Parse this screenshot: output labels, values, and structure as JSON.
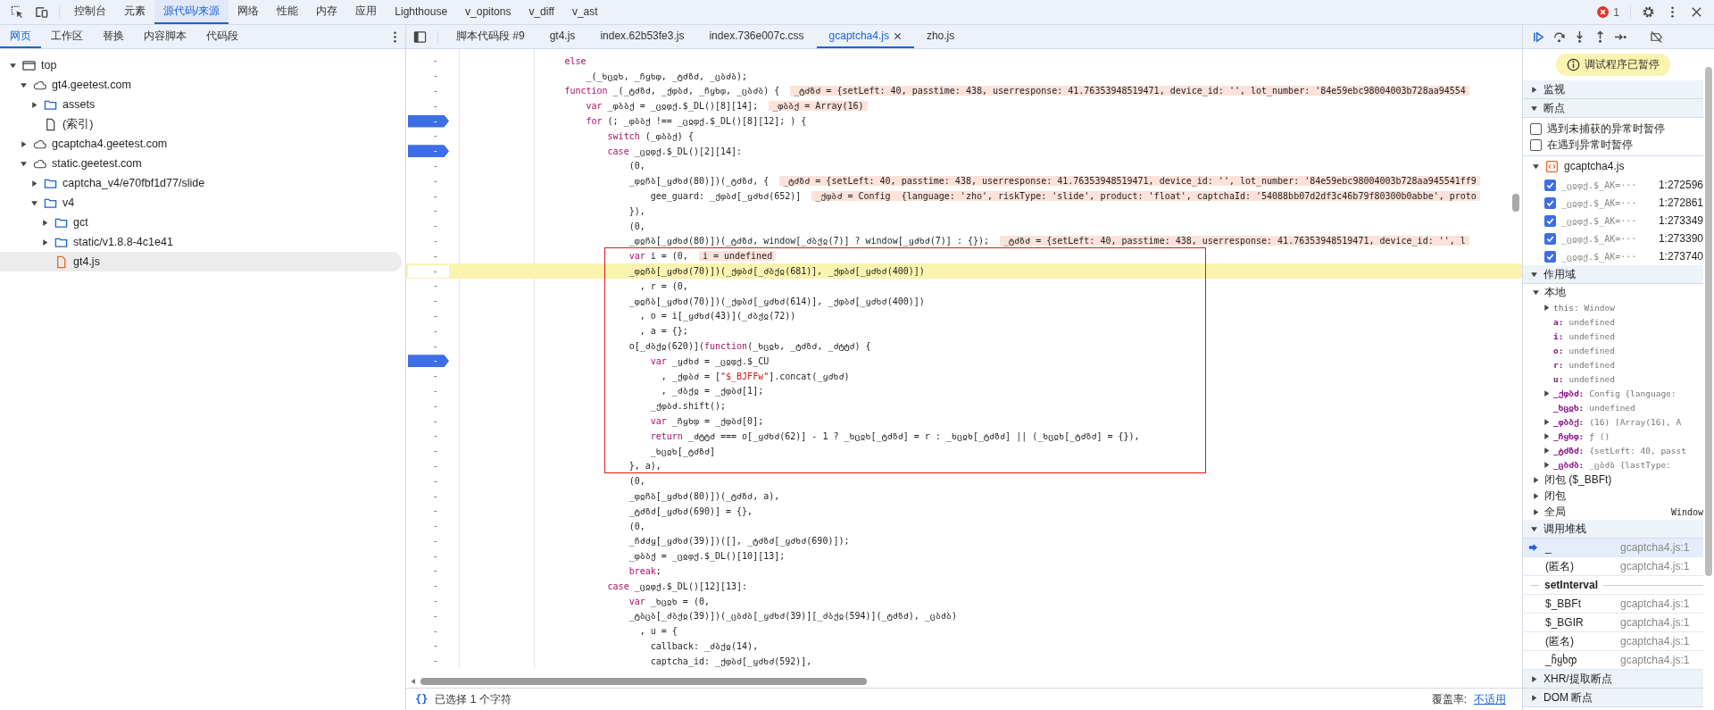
{
  "toolbar": {
    "tabs": [
      {
        "label": "控制台",
        "selected": false
      },
      {
        "label": "元素",
        "selected": false
      },
      {
        "label": "源代码/来源",
        "selected": true
      },
      {
        "label": "网络",
        "selected": false
      },
      {
        "label": "性能",
        "selected": false
      },
      {
        "label": "内存",
        "selected": false
      },
      {
        "label": "应用",
        "selected": false
      },
      {
        "label": "Lighthouse",
        "selected": false
      },
      {
        "label": "v_opitons",
        "selected": false
      },
      {
        "label": "v_diff",
        "selected": false
      },
      {
        "label": "v_ast",
        "selected": false
      }
    ],
    "error_count": "1"
  },
  "navigator": {
    "tabs": [
      {
        "label": "网页",
        "selected": true
      },
      {
        "label": "工作区",
        "selected": false
      },
      {
        "label": "替换",
        "selected": false
      },
      {
        "label": "内容脚本",
        "selected": false
      },
      {
        "label": "代码段",
        "selected": false
      }
    ],
    "tree": {
      "label": "top",
      "kind": "frame",
      "expanded": true,
      "selected": false,
      "children": [
        {
          "label": "gt4.geetest.com",
          "kind": "domain",
          "expanded": true,
          "selected": false,
          "children": [
            {
              "label": "assets",
              "kind": "folder",
              "expanded": false,
              "selected": false
            },
            {
              "label": "(索引)",
              "kind": "file",
              "selected": false
            }
          ]
        },
        {
          "label": "gcaptcha4.geetest.com",
          "kind": "domain",
          "expanded": false,
          "selected": false
        },
        {
          "label": "static.geetest.com",
          "kind": "domain",
          "expanded": true,
          "selected": false,
          "children": [
            {
              "label": "captcha_v4/e70fbf1d77/slide",
              "kind": "folder",
              "expanded": false,
              "selected": false
            },
            {
              "label": "v4",
              "kind": "folder",
              "expanded": true,
              "selected": false,
              "children": [
                {
                  "label": "gct",
                  "kind": "folder",
                  "expanded": false,
                  "selected": false
                },
                {
                  "label": "static/v1.8.8-4c1e41",
                  "kind": "folder",
                  "expanded": false,
                  "selected": false
                },
                {
                  "label": "gt4.js",
                  "kind": "script",
                  "selected": true
                }
              ]
            }
          ]
        }
      ]
    }
  },
  "editor": {
    "tabs": [
      {
        "label": "脚本代码段 #9",
        "selected": false,
        "closable": false
      },
      {
        "label": "gt4.js",
        "selected": false,
        "closable": false
      },
      {
        "label": "index.62b53fe3.js",
        "selected": false,
        "closable": false
      },
      {
        "label": "index.736e007c.css",
        "selected": false,
        "closable": false
      },
      {
        "label": "gcaptcha4.js",
        "selected": true,
        "closable": true
      },
      {
        "label": "zho.js",
        "selected": false,
        "closable": false
      }
    ],
    "lines": [
      {
        "line_number": "-",
        "breakpoint": false,
        "current": false,
        "parts": [
          {
            "kind": "keyword",
            "text": "                    else"
          }
        ]
      },
      {
        "line_number": "-",
        "breakpoint": false,
        "current": false,
        "parts": [
          {
            "kind": "code",
            "text": "                        _(_ხცჲხ, _ჩყხჶ, _ტძზძ, _ცბძბ);"
          }
        ]
      },
      {
        "line_number": "-",
        "breakpoint": false,
        "current": false,
        "parts": [
          {
            "kind": "keyword",
            "text": "                    function"
          },
          {
            "kind": "code",
            "text": " _(_ტძზძ, _ქჶბძ, _ჩყხჶ, _ცბძბ) {"
          }
        ],
        "value": "_ტძზძ = {setLeft: 40, passtime: 438, userresponse: 41.76353948519471, device_id: '', lot_number: '84e59ebc98004003b728aa94554"
      },
      {
        "line_number": "-",
        "breakpoint": false,
        "current": false,
        "parts": [
          {
            "kind": "keyword",
            "text": "                        var"
          },
          {
            "kind": "code",
            "text": " _ჶბბქ = _ცჲჶქ.$_DL()[8][14];"
          }
        ],
        "value": "_ჶბბქ = Array(16)"
      },
      {
        "line_number": "-",
        "breakpoint": true,
        "current": false,
        "parts": [
          {
            "kind": "keyword",
            "text": "                        for"
          },
          {
            "kind": "code",
            "text": " (; _ჶბბქ !== _ცჲჶქ.$_DL()[8][12]; ) {"
          }
        ]
      },
      {
        "line_number": "-",
        "breakpoint": false,
        "current": false,
        "parts": [
          {
            "kind": "keyword",
            "text": "                            switch"
          },
          {
            "kind": "code",
            "text": " (_ჶბბქ) {"
          }
        ]
      },
      {
        "line_number": "-",
        "breakpoint": true,
        "current": false,
        "parts": [
          {
            "kind": "keyword",
            "text": "                            case"
          },
          {
            "kind": "code",
            "text": " _ცჲჶქ.$_DL()[2][14]:"
          }
        ]
      },
      {
        "line_number": "-",
        "breakpoint": false,
        "current": false,
        "parts": [
          {
            "kind": "code",
            "text": "                                (0,"
          }
        ]
      },
      {
        "line_number": "-",
        "breakpoint": false,
        "current": false,
        "parts": [
          {
            "kind": "code",
            "text": "                                _ჶჲჩბ[_ყძხძ(80)])(_ტძზძ, {"
          }
        ],
        "value": "_ტძზძ = {setLeft: 40, passtime: 438, userresponse: 41.76353948519471, device_id: '', lot_number: '84e59ebc98004003b728aa945541ff9"
      },
      {
        "line_number": "-",
        "breakpoint": false,
        "current": false,
        "parts": [
          {
            "kind": "code",
            "text": "                                    gee_guard: _ქჶბძ[_ყძხძ(652)]"
          }
        ],
        "value": "_ქჶბძ = Config  {language: 'zho', riskType: 'slide', product: 'float', captchaId: '54088bb07d2df3c46b79f80300b0abbe', proto"
      },
      {
        "line_number": "-",
        "breakpoint": false,
        "current": false,
        "parts": [
          {
            "kind": "code",
            "text": "                                }),"
          }
        ]
      },
      {
        "line_number": "-",
        "breakpoint": false,
        "current": false,
        "parts": [
          {
            "kind": "code",
            "text": "                                (0,"
          }
        ]
      },
      {
        "line_number": "-",
        "breakpoint": false,
        "current": false,
        "parts": [
          {
            "kind": "code",
            "text": "                                _ჶჲჩბ[_ყძხძ(80)])(_ტძზძ, window[_ძბქჲ(7)] ? window[_ყძხძ(7)] : {});"
          }
        ],
        "value": "_ტძზძ = {setLeft: 40, passtime: 438, userresponse: 41.76353948519471, device_id: '', l"
      },
      {
        "line_number": "-",
        "breakpoint": false,
        "current": false,
        "parts": [
          {
            "kind": "keyword",
            "text": "                                var"
          },
          {
            "kind": "code",
            "text": " i = (0,"
          }
        ],
        "value": "i = undefined"
      },
      {
        "line_number": "-",
        "breakpoint": false,
        "current": true,
        "parts": [
          {
            "kind": "code",
            "text": "                                _ჶჲჩბ[_ყძხძ(70)])(_ქჶბძ[_ძბქჲ(681)], _ქჶბძ[_ყძხძ(400)])"
          }
        ]
      },
      {
        "line_number": "-",
        "breakpoint": false,
        "current": false,
        "parts": [
          {
            "kind": "code",
            "text": "                                  , r = (0,"
          }
        ]
      },
      {
        "line_number": "-",
        "breakpoint": false,
        "current": false,
        "parts": [
          {
            "kind": "code",
            "text": "                                _ჶჲჩბ[_ყძხძ(70)])(_ქჶბძ[_ყძხძ(614)], _ქჶბძ[_ყძხძ(400)])"
          }
        ]
      },
      {
        "line_number": "-",
        "breakpoint": false,
        "current": false,
        "parts": [
          {
            "kind": "code",
            "text": "                                  , o = i[_ყძხძ(43)](_ძბქჲ(72))"
          }
        ]
      },
      {
        "line_number": "-",
        "breakpoint": false,
        "current": false,
        "parts": [
          {
            "kind": "code",
            "text": "                                  , a = {};"
          }
        ]
      },
      {
        "line_number": "-",
        "breakpoint": false,
        "current": false,
        "parts": [
          {
            "kind": "code",
            "text": "                                o[_ძბქჲ(620)]("
          },
          {
            "kind": "keyword",
            "text": "function"
          },
          {
            "kind": "code",
            "text": "(_ხცჲხ, _ტძზძ, _ძტტძ) {"
          }
        ]
      },
      {
        "line_number": "-",
        "breakpoint": true,
        "current": false,
        "parts": [
          {
            "kind": "keyword",
            "text": "                                    var"
          },
          {
            "kind": "code",
            "text": " _ყძხძ = _ცჲჶქ.$_CU"
          }
        ]
      },
      {
        "line_number": "-",
        "breakpoint": false,
        "current": false,
        "parts": [
          {
            "kind": "code",
            "text": "                                      , _ქჶბძ = ["
          },
          {
            "kind": "string",
            "text": "\"$_BJFFw\""
          },
          {
            "kind": "code",
            "text": "].concat(_ყძხძ)"
          }
        ]
      },
      {
        "line_number": "-",
        "breakpoint": false,
        "current": false,
        "parts": [
          {
            "kind": "code",
            "text": "                                      , _ძბქჲ = _ქჶბძ[1];"
          }
        ]
      },
      {
        "line_number": "-",
        "breakpoint": false,
        "current": false,
        "parts": [
          {
            "kind": "code",
            "text": "                                    _ქჶბძ.shift();"
          }
        ]
      },
      {
        "line_number": "-",
        "breakpoint": false,
        "current": false,
        "parts": [
          {
            "kind": "keyword",
            "text": "                                    var"
          },
          {
            "kind": "code",
            "text": " _ჩყხჶ = _ქჶბძ[0];"
          }
        ]
      },
      {
        "line_number": "-",
        "breakpoint": false,
        "current": false,
        "parts": [
          {
            "kind": "keyword",
            "text": "                                    return"
          },
          {
            "kind": "code",
            "text": " _ძტტძ === o[_ყძხძ(62)] - 1 ? _ხცჲხ[_ტძზძ] = r : _ხცჲხ[_ტძზძ] || (_ხცჲხ[_ტძზძ] = {}),"
          }
        ]
      },
      {
        "line_number": "-",
        "breakpoint": false,
        "current": false,
        "parts": [
          {
            "kind": "code",
            "text": "                                    _ხცჲხ[_ტძზძ]"
          }
        ]
      },
      {
        "line_number": "-",
        "breakpoint": false,
        "current": false,
        "parts": [
          {
            "kind": "code",
            "text": "                                }, a),"
          }
        ]
      },
      {
        "line_number": "-",
        "breakpoint": false,
        "current": false,
        "parts": [
          {
            "kind": "code",
            "text": "                                (0,"
          }
        ]
      },
      {
        "line_number": "-",
        "breakpoint": false,
        "current": false,
        "parts": [
          {
            "kind": "code",
            "text": "                                _ჶჲჩბ[_ყძხძ(80)])(_ტძზძ, a),"
          }
        ]
      },
      {
        "line_number": "-",
        "breakpoint": false,
        "current": false,
        "parts": [
          {
            "kind": "code",
            "text": "                                _ტძზძ[_ყძხძ(690)] = {},"
          }
        ]
      },
      {
        "line_number": "-",
        "breakpoint": false,
        "current": false,
        "parts": [
          {
            "kind": "code",
            "text": "                                (0,"
          }
        ]
      },
      {
        "line_number": "-",
        "breakpoint": false,
        "current": false,
        "parts": [
          {
            "kind": "code",
            "text": "                                _ჩძძყ[_ყძხძ(39)])([], _ტძზძ[_ყძხძ(690)]);"
          }
        ]
      },
      {
        "line_number": "-",
        "breakpoint": false,
        "current": false,
        "parts": [
          {
            "kind": "code",
            "text": "                                _ჶბბქ = _ცჲჶქ.$_DL()[10][13];"
          }
        ]
      },
      {
        "line_number": "-",
        "breakpoint": false,
        "current": false,
        "parts": [
          {
            "kind": "keyword",
            "text": "                                break"
          },
          {
            "kind": "code",
            "text": ";"
          }
        ]
      },
      {
        "line_number": "-",
        "breakpoint": false,
        "current": false,
        "parts": [
          {
            "kind": "keyword",
            "text": "                            case"
          },
          {
            "kind": "code",
            "text": " _ცჲჶქ.$_DL()[12][13]:"
          }
        ]
      },
      {
        "line_number": "-",
        "breakpoint": false,
        "current": false,
        "parts": [
          {
            "kind": "keyword",
            "text": "                                var"
          },
          {
            "kind": "code",
            "text": " _ხცჲხ = (0,"
          }
        ]
      },
      {
        "line_number": "-",
        "breakpoint": false,
        "current": false,
        "parts": [
          {
            "kind": "code",
            "text": "                                _ტბცბ[_ძბქჲ(39)])(_ცბძბ[_ყძხძ(39)][_ძბქჲ(594)](_ტძზძ), _ცბძბ)"
          }
        ]
      },
      {
        "line_number": "-",
        "breakpoint": false,
        "current": false,
        "parts": [
          {
            "kind": "code",
            "text": "                                  , u = {"
          }
        ]
      },
      {
        "line_number": "-",
        "breakpoint": false,
        "current": false,
        "parts": [
          {
            "kind": "code",
            "text": "                                    callback: _ძბქჲ(14),"
          }
        ]
      },
      {
        "line_number": "-",
        "breakpoint": false,
        "current": false,
        "parts": [
          {
            "kind": "code",
            "text": "                                    captcha_id: _ქჶბძ[_ყძხძ(592)],"
          }
        ]
      }
    ],
    "status": {
      "pretty_print": "{}",
      "selection": "已选择 1 个字符",
      "coverage_label": "覆盖率:",
      "coverage_value": "不适用"
    }
  },
  "debugger": {
    "paused_message": "调试程序已暂停",
    "watch": {
      "title": "监视",
      "expanded": false
    },
    "breakpoints": {
      "title": "断点",
      "expanded": true,
      "options": [
        {
          "label": "遇到未捕获的异常时暂停",
          "checked": false
        },
        {
          "label": "在遇到异常时暂停",
          "checked": false
        }
      ],
      "file": "gcaptcha4.js",
      "file_expanded": true,
      "items": [
        {
          "code": "_ცჲჶქ.$_AK=···",
          "location": "1:272596",
          "checked": true
        },
        {
          "code": "_ცჲჶქ.$_AK=···",
          "location": "1:272861",
          "checked": true
        },
        {
          "code": "_ცჲჶქ.$_AK=···",
          "location": "1:273349",
          "checked": true
        },
        {
          "code": "_ცჲჶქ.$_AK=···",
          "location": "1:273390",
          "checked": true
        },
        {
          "code": "_ცჲჶქ.$_AK=···",
          "location": "1:273740",
          "checked": true
        }
      ]
    },
    "scope": {
      "title": "作用域",
      "expanded": true,
      "groups": [
        {
          "label": "本地",
          "expanded": true,
          "children": [
            {
              "name": "this:",
              "value": "Window",
              "expanded": false
            },
            {
              "name": "a:",
              "value": "undefined"
            },
            {
              "name": "i:",
              "value": "undefined"
            },
            {
              "name": "o:",
              "value": "undefined"
            },
            {
              "name": "r:",
              "value": "undefined"
            },
            {
              "name": "u:",
              "value": "undefined"
            },
            {
              "name": "_ქჶბძ:",
              "value": "Config  {language:",
              "expanded": false
            },
            {
              "name": "_ხცჲხ:",
              "value": "undefined"
            },
            {
              "name": "_ჶბბქ:",
              "value": "(16)  [Array(16), A",
              "expanded": false
            },
            {
              "name": "_ჩყხჶ:",
              "value": "ƒ ()",
              "expanded": false
            },
            {
              "name": "_ტძზძ:",
              "value": "{setLeft: 40, passt",
              "expanded": false
            },
            {
              "name": "_ცბძბ:",
              "value": "_ცბძბ  {lastType:",
              "expanded": false
            }
          ]
        },
        {
          "label": "闭包 ($_BBFt)",
          "expanded": false
        },
        {
          "label": "闭包",
          "expanded": false
        },
        {
          "label": "全局",
          "expanded": false,
          "value": "Window"
        }
      ]
    },
    "call_stack": {
      "title": "调用堆栈",
      "expanded": true,
      "frames": [
        {
          "kind": "frame",
          "name": "_",
          "location": "gcaptcha4.js:1",
          "selected": true
        },
        {
          "kind": "frame",
          "name": "(匿名)",
          "location": "gcaptcha4.js:1",
          "selected": false
        },
        {
          "kind": "async",
          "name": "setInterval",
          "selected": false
        },
        {
          "kind": "frame",
          "name": "$_BBFt",
          "location": "gcaptcha4.js:1",
          "selected": false
        },
        {
          "kind": "frame",
          "name": "$_BGIR",
          "location": "gcaptcha4.js:1",
          "selected": false
        },
        {
          "kind": "frame",
          "name": "(匿名)",
          "location": "gcaptcha4.js:1",
          "selected": false
        },
        {
          "kind": "frame",
          "name": "_ჩყხჶ",
          "location": "gcaptcha4.js:1",
          "selected": false
        }
      ]
    },
    "xhr": {
      "title": "XHR/提取断点",
      "expanded": false
    },
    "dom": {
      "title": "DOM 断点",
      "expanded": false
    }
  }
}
